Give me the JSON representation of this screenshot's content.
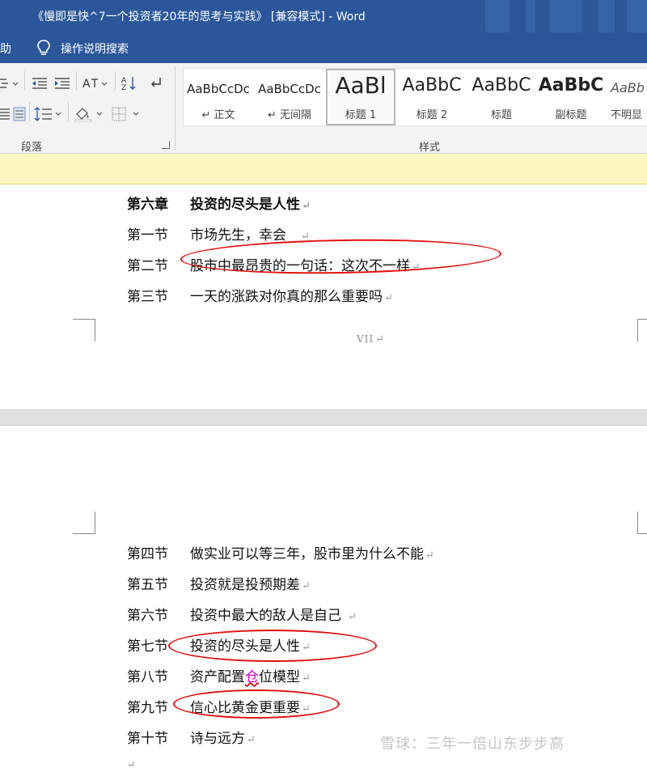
{
  "window": {
    "title": "《慢即是快^7一个投资者20年的思考与实践》 [兼容模式] - Word"
  },
  "menubar": {
    "help_label": "助",
    "tellme_label": "操作说明搜索"
  },
  "ribbon": {
    "paragraph_group_label": "段落",
    "styles_group_label": "样式",
    "styles": [
      {
        "sample": "AaBbCcDc",
        "name": "↵ 正文"
      },
      {
        "sample": "AaBbCcDc",
        "name": "↵ 无间隔"
      },
      {
        "sample": "AaBl",
        "name": "标题 1"
      },
      {
        "sample": "AaBbC",
        "name": "标题 2"
      },
      {
        "sample": "AaBbC",
        "name": "标题"
      },
      {
        "sample": "AaBbC",
        "name": "副标题"
      },
      {
        "sample": "AaBb",
        "name": "不明显"
      }
    ]
  },
  "document": {
    "page1": {
      "chapter": {
        "label": "第六章",
        "title": "投资的尽头是人性"
      },
      "sections": [
        {
          "label": "第一节",
          "title": "市场先生，幸会"
        },
        {
          "label": "第二节",
          "title": "股市中最昂贵的一句话：这次不一样"
        },
        {
          "label": "第三节",
          "title": "一天的涨跌对你真的那么重要吗"
        }
      ],
      "footer": "VII"
    },
    "page2": {
      "sections": [
        {
          "label": "第四节",
          "title": "做实业可以等三年，股市里为什么不能"
        },
        {
          "label": "第五节",
          "title": "投资就是投预期差"
        },
        {
          "label": "第六节",
          "title": "投资中最大的敌人是自己"
        },
        {
          "label": "第七节",
          "title": "投资的尽头是人性"
        },
        {
          "label": "第八节",
          "title_before": "资产配置",
          "title_typo": "仓",
          "title_after": "位模型"
        },
        {
          "label": "第九节",
          "title": "信心比黄金更重要"
        },
        {
          "label": "第十节",
          "title": "诗与远方"
        }
      ]
    },
    "paragraph_mark": "↵"
  },
  "watermark": "雪球：三年一倍山东步步高",
  "colors": {
    "titlebar": "#2b579a",
    "annotation": "#e01010",
    "notice": "#fdf6c1"
  }
}
